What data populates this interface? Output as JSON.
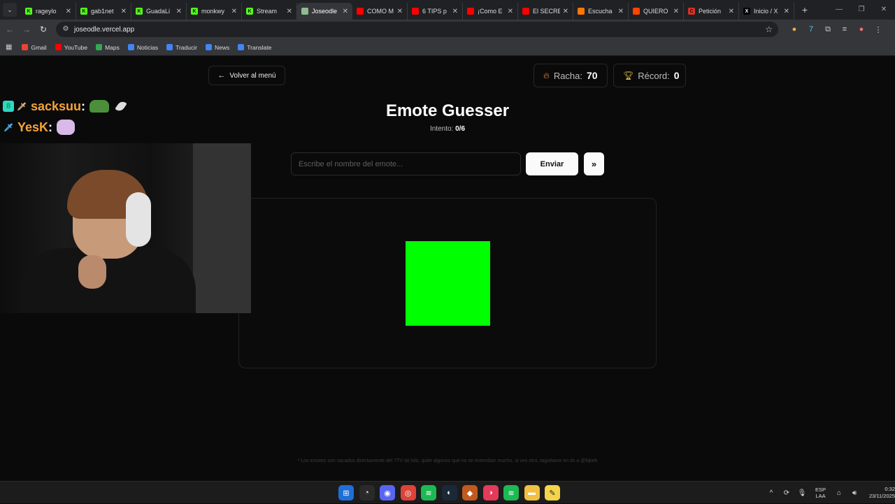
{
  "tabs": [
    {
      "title": "rageylo",
      "fav_color": "#53fc18",
      "fav_glyph": "K",
      "active": false
    },
    {
      "title": "gab1net",
      "fav_color": "#53fc18",
      "fav_glyph": "K",
      "active": false
    },
    {
      "title": "GuadaLi",
      "fav_color": "#53fc18",
      "fav_glyph": "K",
      "active": false
    },
    {
      "title": "monkwy",
      "fav_color": "#53fc18",
      "fav_glyph": "K",
      "active": false
    },
    {
      "title": "Stream",
      "fav_color": "#53fc18",
      "fav_glyph": "K",
      "active": false
    },
    {
      "title": "Joseodle",
      "fav_color": "#8fbc8f",
      "fav_glyph": "",
      "active": true
    },
    {
      "title": "COMO M",
      "fav_color": "#ff0000",
      "fav_glyph": "",
      "active": false
    },
    {
      "title": "6 TIPS p",
      "fav_color": "#ff0000",
      "fav_glyph": "",
      "active": false
    },
    {
      "title": "¡Como E",
      "fav_color": "#ff0000",
      "fav_glyph": "",
      "active": false
    },
    {
      "title": "El SECRE",
      "fav_color": "#ff0000",
      "fav_glyph": "",
      "active": false
    },
    {
      "title": "Escucha",
      "fav_color": "#ff7700",
      "fav_glyph": "",
      "active": false
    },
    {
      "title": "QUIERO",
      "fav_color": "#ff4500",
      "fav_glyph": "",
      "active": false
    },
    {
      "title": "Petición",
      "fav_color": "#d93025",
      "fav_glyph": "C",
      "active": false
    },
    {
      "title": "Inicio / X",
      "fav_color": "#000000",
      "fav_glyph": "X",
      "active": false
    }
  ],
  "browser": {
    "url": "joseodle.vercel.app"
  },
  "bookmarks": [
    {
      "label": "Gmail",
      "color": "#ea4335"
    },
    {
      "label": "YouTube",
      "color": "#ff0000"
    },
    {
      "label": "Maps",
      "color": "#34a853"
    },
    {
      "label": "Noticias",
      "color": "#4285f4"
    },
    {
      "label": "Traducir",
      "color": "#4285f4"
    },
    {
      "label": "News",
      "color": "#4285f4"
    },
    {
      "label": "Translate",
      "color": "#4285f4"
    }
  ],
  "page": {
    "back_label": "Volver al menú",
    "streak_label": "Racha:",
    "streak_value": "70",
    "record_label": "Récord:",
    "record_value": "0",
    "title": "Emote Guesser",
    "attempt_label": "Intento:",
    "attempt_value": "0/6",
    "input_placeholder": "Escribe el nombre del emote...",
    "send_label": "Enviar",
    "skip_label": "»",
    "emote_color": "#00ff00",
    "footnote": "* Los emotes son sacados directamente del 7TV de lolo, quite algunos que no se entendian mucho, si ves otro, taguéame en ds a @fqkeh"
  },
  "overlay": {
    "chat": [
      {
        "user": "sacksuu"
      },
      {
        "user": "YesK"
      }
    ]
  },
  "taskbar": {
    "lang_line1": "ESP",
    "lang_line2": "LAA",
    "time": "0:32",
    "date": "23/11/2025"
  }
}
